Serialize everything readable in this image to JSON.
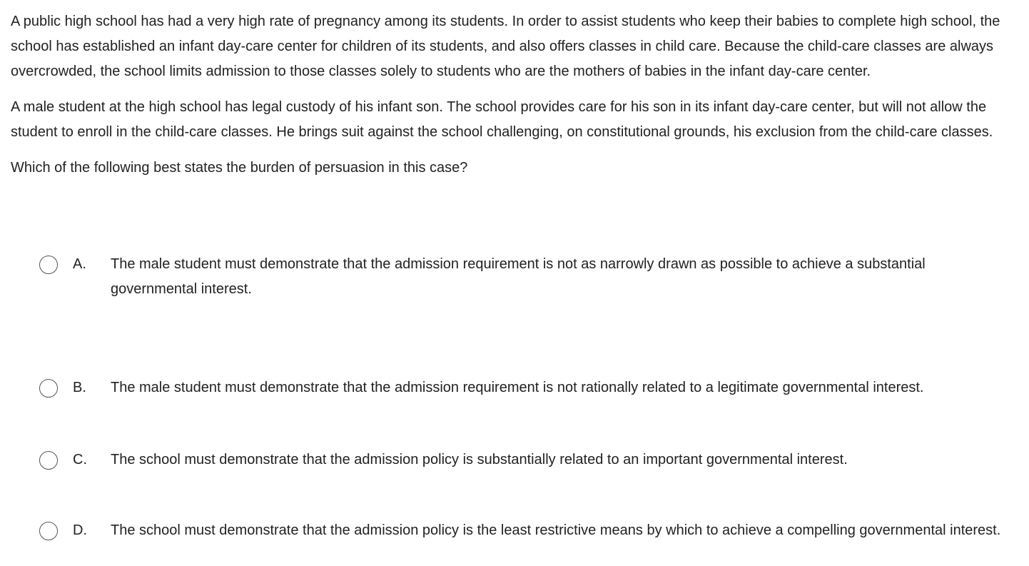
{
  "question": {
    "paragraphs": [
      "A public high school has had a very high rate of pregnancy among its students.  In order to assist students who keep their babies to complete high school, the school has established an infant day-care center for children of its students, and also offers classes in child care.  Because the child-care classes are always overcrowded, the school limits admission to those classes solely to students who are the mothers of babies in the infant day-care center.",
      "A male student at the high school has legal custody of his infant son.  The school provides care for his son in its infant day-care center, but will not allow the student to enroll in the child-care classes.  He brings suit against the school challenging, on constitutional grounds, his exclusion from the child-care classes."
    ],
    "prompt": "Which of the following best states the burden of persuasion in this case?"
  },
  "options": [
    {
      "letter": "A.",
      "text": "The male student must demonstrate that the admission requirement is not as narrowly drawn as possible to achieve a substantial governmental interest.",
      "selected": false
    },
    {
      "letter": "B.",
      "text": "The male student must demonstrate that the admission requirement is not rationally related to a legitimate governmental interest.",
      "selected": false
    },
    {
      "letter": "C.",
      "text": "The school must demonstrate that the admission policy is substantially related to an important governmental interest.",
      "selected": false
    },
    {
      "letter": "D.",
      "text": "The school must demonstrate that the admission policy is the least restrictive means by which to achieve a compelling governmental interest.",
      "selected": false
    }
  ]
}
